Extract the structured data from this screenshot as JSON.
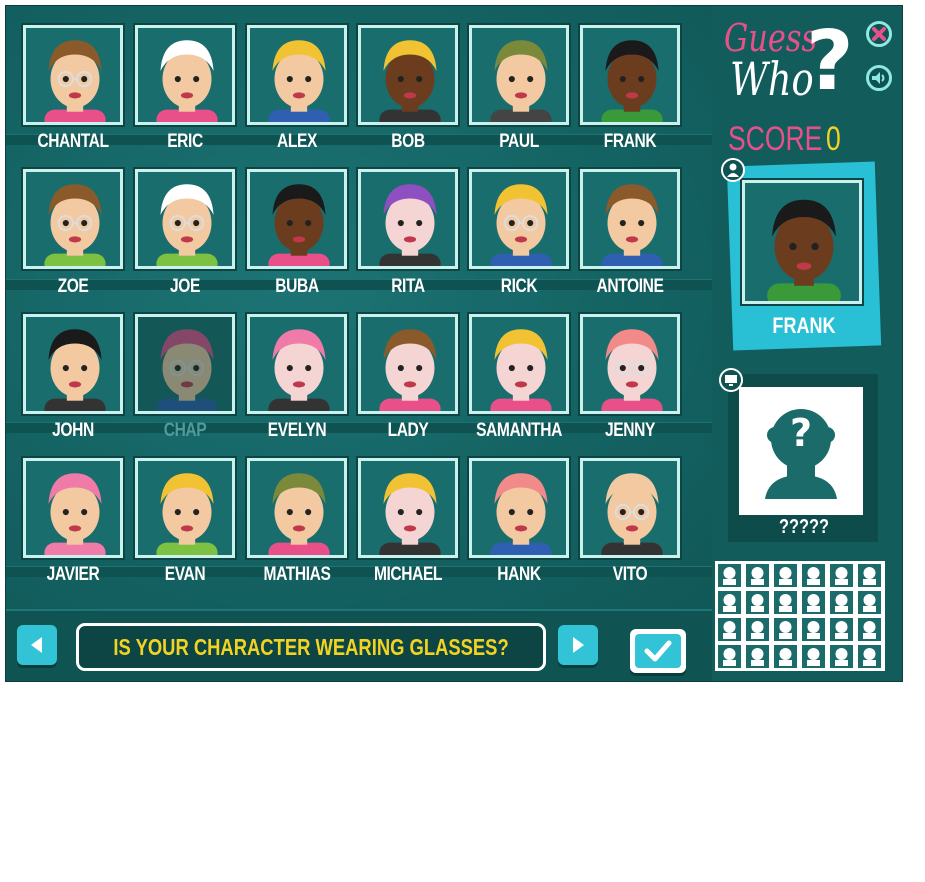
{
  "game": {
    "logo_line1": "Guess",
    "logo_line2": "Who",
    "logo_mark": "?",
    "score_label": "SCORE",
    "score_value": "0",
    "question": "IS YOUR CHARACTER WEARING GLASSES?",
    "colors": {
      "panel": "#125c5c",
      "accent_pink": "#e8508a",
      "accent_yellow": "#f3d321",
      "accent_cyan": "#33c3d6"
    }
  },
  "characters": [
    {
      "name": "CHANTAL",
      "hair": "#8b5a2b",
      "skin": "#f2c9a0",
      "shirt": "#e9508a",
      "glasses": true
    },
    {
      "name": "ERIC",
      "hair": "#ffffff",
      "skin": "#f2c9a0",
      "shirt": "#e9508a",
      "glasses": false
    },
    {
      "name": "ALEX",
      "hair": "#f1c232",
      "skin": "#f2c9a0",
      "shirt": "#2f5fb0",
      "glasses": false
    },
    {
      "name": "BOB",
      "hair": "#f1c232",
      "skin": "#6b3d1e",
      "shirt": "#333333",
      "glasses": false
    },
    {
      "name": "PAUL",
      "hair": "#7a8a3a",
      "skin": "#f2c9a0",
      "shirt": "#444444",
      "glasses": false
    },
    {
      "name": "FRANK",
      "hair": "#1a1a1a",
      "skin": "#6b3d1e",
      "shirt": "#3a9a3a",
      "glasses": false
    },
    {
      "name": "ZOE",
      "hair": "#8b5a2b",
      "skin": "#f2c9a0",
      "shirt": "#7dc142",
      "glasses": true
    },
    {
      "name": "JOE",
      "hair": "#ffffff",
      "skin": "#f2c9a0",
      "shirt": "#7dc142",
      "glasses": true
    },
    {
      "name": "BUBA",
      "hair": "#1a1a1a",
      "skin": "#6b3d1e",
      "shirt": "#e9508a",
      "glasses": false
    },
    {
      "name": "RITA",
      "hair": "#8e4fc0",
      "skin": "#f5d4d4",
      "shirt": "#333333",
      "glasses": false
    },
    {
      "name": "RICK",
      "hair": "#f1c232",
      "skin": "#f2c9a0",
      "shirt": "#2f5fb0",
      "glasses": true
    },
    {
      "name": "ANTOINE",
      "hair": "#8b5a2b",
      "skin": "#f2c9a0",
      "shirt": "#2f5fb0",
      "glasses": false
    },
    {
      "name": "JOHN",
      "hair": "#1a1a1a",
      "skin": "#f2c9a0",
      "shirt": "#333333",
      "glasses": false
    },
    {
      "name": "CHAP",
      "hair": "#e9508a",
      "skin": "#f2c9a0",
      "shirt": "#2f5fb0",
      "glasses": true
    },
    {
      "name": "EVELYN",
      "hair": "#f07aa8",
      "skin": "#f5d4d4",
      "shirt": "#333333",
      "glasses": false
    },
    {
      "name": "LADY",
      "hair": "#8b5a2b",
      "skin": "#f5d4d4",
      "shirt": "#e9508a",
      "glasses": false
    },
    {
      "name": "SAMANTHA",
      "hair": "#f1c232",
      "skin": "#f5d4d4",
      "shirt": "#e9508a",
      "glasses": false
    },
    {
      "name": "JENNY",
      "hair": "#f28a8a",
      "skin": "#f5d4d4",
      "shirt": "#e9508a",
      "glasses": true
    },
    {
      "name": "JAVIER",
      "hair": "#f07aa8",
      "skin": "#f2c9a0",
      "shirt": "#f07aa8",
      "glasses": false
    },
    {
      "name": "EVAN",
      "hair": "#f1c232",
      "skin": "#f2c9a0",
      "shirt": "#7dc142",
      "glasses": false
    },
    {
      "name": "MATHIAS",
      "hair": "#7a8a3a",
      "skin": "#f2c9a0",
      "shirt": "#e9508a",
      "glasses": false
    },
    {
      "name": "MICHAEL",
      "hair": "#f1c232",
      "skin": "#f5d4d4",
      "shirt": "#333333",
      "glasses": false
    },
    {
      "name": "HANK",
      "hair": "#f28a8a",
      "skin": "#f2c9a0",
      "shirt": "#2f5fb0",
      "glasses": false
    },
    {
      "name": "VITO",
      "hair": "#f2c9a0",
      "skin": "#f2c9a0",
      "shirt": "#333333",
      "glasses": true
    }
  ],
  "player": {
    "name": "FRANK",
    "icon": "user-icon"
  },
  "opponent": {
    "name": "?????",
    "icon": "monitor-icon",
    "mystery_mark": "?"
  },
  "icons": {
    "close": "close-icon",
    "sound": "sound-icon",
    "prev": "arrow-left-icon",
    "next": "arrow-right-icon",
    "confirm": "checkmark-icon"
  }
}
